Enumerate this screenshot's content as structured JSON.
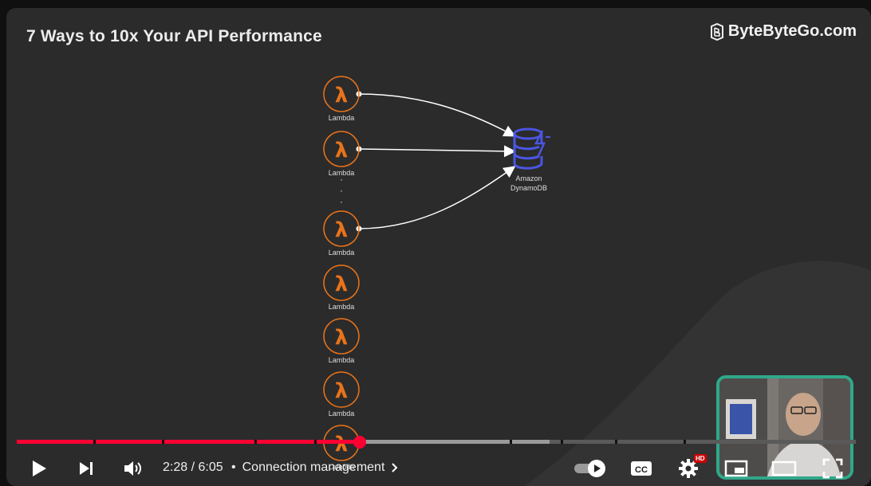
{
  "video": {
    "title": "7 Ways to 10x Your API Performance",
    "brand": "ByteByteGo.com"
  },
  "diagram": {
    "lambda_label": "Lambda",
    "lambdas": [
      "Lambda",
      "Lambda",
      "Lambda",
      "Lambda",
      "Lambda",
      "Lambda",
      "Lambda"
    ],
    "ellipsis": "·",
    "dynamo_label_1": "Amazon",
    "dynamo_label_2": "DynamoDB",
    "colors": {
      "lambda": "#e8731a",
      "dynamo": "#4a56e2",
      "arrow": "#ffffff"
    }
  },
  "player": {
    "time_current": "2:28",
    "time_total": "6:05",
    "time_sep": " / ",
    "chapter_sep": "•",
    "chapter": "Connection management",
    "hd_badge": "HD",
    "progress": {
      "played_fraction": 0.409,
      "buffered_fraction": 0.635
    },
    "icons": [
      "play-icon",
      "next-icon",
      "volume-icon",
      "autoplay-toggle-icon",
      "captions-icon",
      "settings-icon",
      "miniplayer-icon",
      "theater-icon",
      "fullscreen-icon"
    ],
    "colors": {
      "played": "#ff0033",
      "buffered": "#9a9a9a",
      "track": "#5a5a5a"
    }
  }
}
